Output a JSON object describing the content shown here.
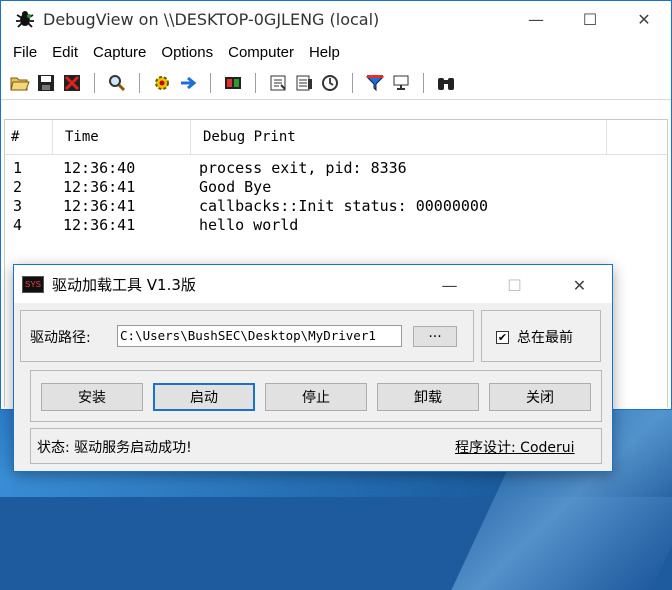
{
  "debugview": {
    "title": "DebugView on \\\\DESKTOP-0GJLENG (local)",
    "menu": [
      "File",
      "Edit",
      "Capture",
      "Options",
      "Computer",
      "Help"
    ],
    "columns": [
      "#",
      "Time",
      "Debug Print"
    ],
    "rows": [
      {
        "num": "1",
        "time": "12:36:40",
        "text": "process exit, pid: 8336"
      },
      {
        "num": "2",
        "time": "12:36:41",
        "text": "Good Bye"
      },
      {
        "num": "3",
        "time": "12:36:41",
        "text": "callbacks::Init status: 00000000"
      },
      {
        "num": "4",
        "time": "12:36:41",
        "text": "hello world"
      }
    ]
  },
  "window_controls": {
    "minimize": "—",
    "maximize": "☐",
    "close": "✕"
  },
  "loader": {
    "icon_text": "SYS",
    "title": "驱动加载工具 V1.3版",
    "path_label": "驱动路径:",
    "path_value": "C:\\Users\\BushSEC\\Desktop\\MyDriver1",
    "browse_label": "···",
    "always_on_top_label": "总在最前",
    "always_on_top_checked": true,
    "buttons": {
      "install": "安装",
      "start": "启动",
      "stop": "停止",
      "uninstall": "卸载",
      "close": "关闭"
    },
    "status_text": "状态: 驱动服务启动成功!",
    "credit_text": "程序设计: Coderui"
  }
}
